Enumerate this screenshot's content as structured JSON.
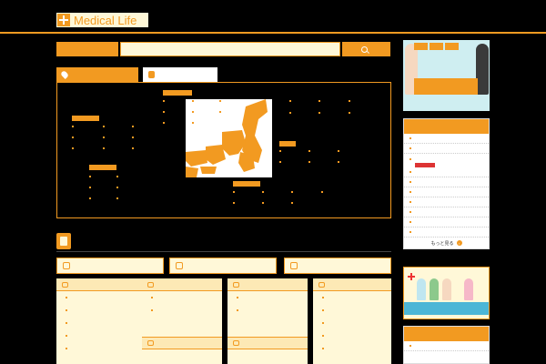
{
  "header": {
    "tagline": "",
    "logo_text": "Medical Life",
    "link": ""
  },
  "search": {
    "label": "",
    "placeholder": "",
    "button_label": ""
  },
  "tabs": [
    {
      "label": "",
      "icon": "pin-icon",
      "active": true
    },
    {
      "label": "",
      "icon": "train-icon",
      "active": false
    }
  ],
  "map": {
    "regions": [
      {
        "label": ""
      },
      {
        "label": ""
      },
      {
        "label": ""
      },
      {
        "label": ""
      },
      {
        "label": ""
      }
    ],
    "prefectures": [
      "",
      "",
      "",
      "",
      "",
      "",
      "",
      "",
      "",
      "",
      "",
      "",
      "",
      "",
      "",
      "",
      "",
      "",
      "",
      "",
      "",
      "",
      "",
      "",
      "",
      "",
      "",
      "",
      "",
      "",
      "",
      "",
      "",
      "",
      "",
      "",
      "",
      "",
      "",
      "",
      "",
      "",
      "",
      "",
      "",
      "",
      ""
    ]
  },
  "category": {
    "title": "",
    "tabs": [
      {
        "label": "",
        "icon": "car-icon"
      },
      {
        "label": "",
        "icon": "pill-icon"
      },
      {
        "label": "",
        "icon": "building-icon"
      }
    ],
    "columns": [
      {
        "head": "",
        "icon": "tooth-icon",
        "items": [
          "",
          "",
          "",
          "",
          ""
        ]
      },
      {
        "head": "",
        "icon": "glasses-icon",
        "items": [
          "",
          ""
        ],
        "sub_head": "",
        "sub_icon": "ear-icon",
        "sub_items": []
      },
      {
        "head": "",
        "icon": "leaf-icon",
        "items": [
          "",
          ""
        ],
        "sub_head": "",
        "sub_icon": "bone-icon",
        "sub_items": []
      },
      {
        "head": "",
        "icon": "bone-icon",
        "items": [
          "",
          "",
          "",
          "",
          ""
        ]
      }
    ]
  },
  "sidebar": {
    "ad_tags": [
      "",
      "",
      ""
    ],
    "ad_sub": "",
    "ad_main": "",
    "new_jobs": {
      "title": "",
      "items": [
        "",
        "",
        "",
        "",
        "",
        "",
        "",
        "",
        "",
        "",
        ""
      ],
      "new_badge": "",
      "more": "もっと見る"
    },
    "ad2_text": "",
    "new_visits": {
      "title": "",
      "items": [
        ""
      ]
    }
  },
  "colors": {
    "accent": "#f29a21",
    "cream": "#fff8d8",
    "sky": "#4cb6d6"
  }
}
